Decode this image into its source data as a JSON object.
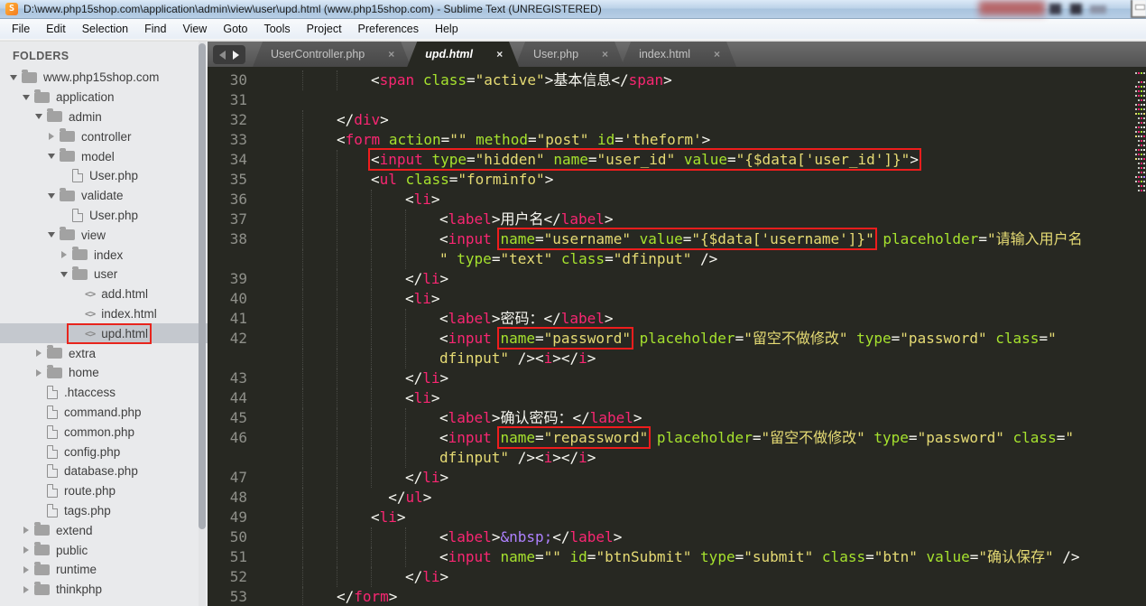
{
  "window": {
    "title": "D:\\www.php15shop.com\\application\\admin\\view\\user\\upd.html (www.php15shop.com) - Sublime Text (UNREGISTERED)",
    "logo_letter": "S",
    "menus": [
      "File",
      "Edit",
      "Selection",
      "Find",
      "View",
      "Goto",
      "Tools",
      "Project",
      "Preferences",
      "Help"
    ]
  },
  "tabs": [
    {
      "label": "UserController.php",
      "close": "×",
      "active": false
    },
    {
      "label": "upd.html",
      "close": "×",
      "active": true
    },
    {
      "label": "User.php",
      "close": "×",
      "active": false
    },
    {
      "label": "index.html",
      "close": "×",
      "active": false
    }
  ],
  "sidebar": {
    "header": "FOLDERS",
    "items": [
      {
        "label": "www.php15shop.com",
        "lv": 0,
        "icon": "folder",
        "arrow": "open"
      },
      {
        "label": "application",
        "lv": 1,
        "icon": "folder",
        "arrow": "open"
      },
      {
        "label": "admin",
        "lv": 2,
        "icon": "folder",
        "arrow": "open"
      },
      {
        "label": "controller",
        "lv": 3,
        "icon": "folder",
        "arrow": "closed"
      },
      {
        "label": "model",
        "lv": 3,
        "icon": "folder",
        "arrow": "open"
      },
      {
        "label": "User.php",
        "lv": 4,
        "icon": "file"
      },
      {
        "label": "validate",
        "lv": 3,
        "icon": "folder",
        "arrow": "open"
      },
      {
        "label": "User.php",
        "lv": 4,
        "icon": "file"
      },
      {
        "label": "view",
        "lv": 3,
        "icon": "folder",
        "arrow": "open"
      },
      {
        "label": "index",
        "lv": 4,
        "icon": "folder",
        "arrow": "closed"
      },
      {
        "label": "user",
        "lv": 4,
        "icon": "folder",
        "arrow": "open"
      },
      {
        "label": "add.html",
        "lv": 5,
        "icon": "html"
      },
      {
        "label": "index.html",
        "lv": 5,
        "icon": "html"
      },
      {
        "label": "upd.html",
        "lv": 5,
        "icon": "html",
        "selected": true,
        "boxed": true
      },
      {
        "label": "extra",
        "lv": 2,
        "icon": "folder",
        "arrow": "closed"
      },
      {
        "label": "home",
        "lv": 2,
        "icon": "folder",
        "arrow": "closed"
      },
      {
        "label": ".htaccess",
        "lv": 2,
        "icon": "file"
      },
      {
        "label": "command.php",
        "lv": 2,
        "icon": "file"
      },
      {
        "label": "common.php",
        "lv": 2,
        "icon": "file"
      },
      {
        "label": "config.php",
        "lv": 2,
        "icon": "file"
      },
      {
        "label": "database.php",
        "lv": 2,
        "icon": "file"
      },
      {
        "label": "route.php",
        "lv": 2,
        "icon": "file"
      },
      {
        "label": "tags.php",
        "lv": 2,
        "icon": "file"
      },
      {
        "label": "extend",
        "lv": 1,
        "icon": "folder",
        "arrow": "closed"
      },
      {
        "label": "public",
        "lv": 1,
        "icon": "folder",
        "arrow": "closed"
      },
      {
        "label": "runtime",
        "lv": 1,
        "icon": "folder",
        "arrow": "closed"
      },
      {
        "label": "thinkphp",
        "lv": 1,
        "icon": "folder",
        "arrow": "closed"
      }
    ]
  },
  "editor": {
    "colors": {
      "bg": "#272822",
      "tag": "#f92672",
      "attr": "#a6e22e",
      "string": "#e6db74",
      "entity": "#ae81ff",
      "plain": "#f8f8f2",
      "gutter": "#8f908a",
      "annotation": "#ee1d1d"
    },
    "rows": [
      {
        "n": "30",
        "i": 2,
        "t": [
          [
            "p",
            "<"
          ],
          [
            "t",
            "span"
          ],
          [
            "w",
            " "
          ],
          [
            "a",
            "class"
          ],
          [
            "p",
            "="
          ],
          [
            "s",
            "\"active\""
          ],
          [
            "p",
            ">"
          ],
          [
            "x",
            "基本信息"
          ],
          [
            "p",
            "</"
          ],
          [
            "t",
            "span"
          ],
          [
            "p",
            ">"
          ]
        ]
      },
      {
        "n": "31",
        "i": 0,
        "t": []
      },
      {
        "n": "32",
        "i": 1,
        "t": [
          [
            "p",
            "</"
          ],
          [
            "t",
            "div"
          ],
          [
            "p",
            ">"
          ]
        ]
      },
      {
        "n": "33",
        "i": 1,
        "t": [
          [
            "p",
            "<"
          ],
          [
            "t",
            "form"
          ],
          [
            "w",
            " "
          ],
          [
            "a",
            "action"
          ],
          [
            "p",
            "="
          ],
          [
            "s",
            "\"\""
          ],
          [
            "w",
            " "
          ],
          [
            "a",
            "method"
          ],
          [
            "p",
            "="
          ],
          [
            "s",
            "\"post\""
          ],
          [
            "w",
            " "
          ],
          [
            "a",
            "id"
          ],
          [
            "p",
            "="
          ],
          [
            "s",
            "'theform'"
          ],
          [
            "p",
            ">"
          ]
        ]
      },
      {
        "n": "34",
        "i": 2,
        "t": [
          [
            "b",
            [
              [
                "p",
                "<"
              ],
              [
                "t",
                "input"
              ],
              [
                "w",
                " "
              ],
              [
                "a",
                "type"
              ],
              [
                "p",
                "="
              ],
              [
                "s",
                "\"hidden\""
              ],
              [
                "w",
                " "
              ],
              [
                "a",
                "name"
              ],
              [
                "p",
                "="
              ],
              [
                "s",
                "\"user_id\""
              ],
              [
                "w",
                " "
              ],
              [
                "a",
                "value"
              ],
              [
                "p",
                "="
              ],
              [
                "s",
                "\"{$data['user_id']}\""
              ],
              [
                "p",
                ">"
              ]
            ]
          ]
        ]
      },
      {
        "n": "35",
        "i": 2,
        "t": [
          [
            "p",
            "<"
          ],
          [
            "t",
            "ul"
          ],
          [
            "w",
            " "
          ],
          [
            "a",
            "class"
          ],
          [
            "p",
            "="
          ],
          [
            "s",
            "\"forminfo\""
          ],
          [
            "p",
            ">"
          ]
        ]
      },
      {
        "n": "36",
        "i": 3,
        "t": [
          [
            "p",
            "<"
          ],
          [
            "t",
            "li"
          ],
          [
            "p",
            ">"
          ]
        ]
      },
      {
        "n": "37",
        "i": 4,
        "t": [
          [
            "p",
            "<"
          ],
          [
            "t",
            "label"
          ],
          [
            "p",
            ">"
          ],
          [
            "x",
            "用户名"
          ],
          [
            "p",
            "</"
          ],
          [
            "t",
            "label"
          ],
          [
            "p",
            ">"
          ]
        ]
      },
      {
        "n": "38",
        "i": 4,
        "t": [
          [
            "p",
            "<"
          ],
          [
            "t",
            "input"
          ],
          [
            "w",
            " "
          ],
          [
            "b",
            [
              [
                "a",
                "name"
              ],
              [
                "p",
                "="
              ],
              [
                "s",
                "\"username\""
              ],
              [
                "w",
                " "
              ],
              [
                "a",
                "value"
              ],
              [
                "p",
                "="
              ],
              [
                "s",
                "\"{$data['username']}\""
              ]
            ]
          ],
          [
            "w",
            " "
          ],
          [
            "a",
            "placeholder"
          ],
          [
            "p",
            "="
          ],
          [
            "s",
            "\"请输入用户名"
          ]
        ]
      },
      {
        "n": "",
        "i": 4,
        "t": [
          [
            "s",
            "\""
          ],
          [
            "w",
            " "
          ],
          [
            "a",
            "type"
          ],
          [
            "p",
            "="
          ],
          [
            "s",
            "\"text\""
          ],
          [
            "w",
            " "
          ],
          [
            "a",
            "class"
          ],
          [
            "p",
            "="
          ],
          [
            "s",
            "\"dfinput\""
          ],
          [
            "w",
            " "
          ],
          [
            "p",
            "/>"
          ]
        ]
      },
      {
        "n": "39",
        "i": 3,
        "t": [
          [
            "p",
            "</"
          ],
          [
            "t",
            "li"
          ],
          [
            "p",
            ">"
          ]
        ]
      },
      {
        "n": "40",
        "i": 3,
        "t": [
          [
            "p",
            "<"
          ],
          [
            "t",
            "li"
          ],
          [
            "p",
            ">"
          ]
        ]
      },
      {
        "n": "41",
        "i": 4,
        "t": [
          [
            "p",
            "<"
          ],
          [
            "t",
            "label"
          ],
          [
            "p",
            ">"
          ],
          [
            "x",
            "密码："
          ],
          [
            "p",
            "</"
          ],
          [
            "t",
            "label"
          ],
          [
            "p",
            ">"
          ]
        ]
      },
      {
        "n": "42",
        "i": 4,
        "t": [
          [
            "p",
            "<"
          ],
          [
            "t",
            "input"
          ],
          [
            "w",
            " "
          ],
          [
            "b",
            [
              [
                "a",
                "name"
              ],
              [
                "p",
                "="
              ],
              [
                "s",
                "\"password\""
              ]
            ]
          ],
          [
            "w",
            " "
          ],
          [
            "a",
            "placeholder"
          ],
          [
            "p",
            "="
          ],
          [
            "s",
            "\"留空不做修改\""
          ],
          [
            "w",
            " "
          ],
          [
            "a",
            "type"
          ],
          [
            "p",
            "="
          ],
          [
            "s",
            "\"password\""
          ],
          [
            "w",
            " "
          ],
          [
            "a",
            "class"
          ],
          [
            "p",
            "="
          ],
          [
            "s",
            "\""
          ]
        ]
      },
      {
        "n": "",
        "i": 4,
        "t": [
          [
            "s",
            "dfinput\""
          ],
          [
            "w",
            " "
          ],
          [
            "p",
            "/>"
          ],
          [
            "p",
            "<"
          ],
          [
            "t",
            "i"
          ],
          [
            "p",
            ">"
          ],
          [
            "p",
            "</"
          ],
          [
            "t",
            "i"
          ],
          [
            "p",
            ">"
          ]
        ]
      },
      {
        "n": "43",
        "i": 3,
        "t": [
          [
            "p",
            "</"
          ],
          [
            "t",
            "li"
          ],
          [
            "p",
            ">"
          ]
        ]
      },
      {
        "n": "44",
        "i": 3,
        "t": [
          [
            "p",
            "<"
          ],
          [
            "t",
            "li"
          ],
          [
            "p",
            ">"
          ]
        ]
      },
      {
        "n": "45",
        "i": 4,
        "t": [
          [
            "p",
            "<"
          ],
          [
            "t",
            "label"
          ],
          [
            "p",
            ">"
          ],
          [
            "x",
            "确认密码："
          ],
          [
            "p",
            "</"
          ],
          [
            "t",
            "label"
          ],
          [
            "p",
            ">"
          ]
        ]
      },
      {
        "n": "46",
        "i": 4,
        "t": [
          [
            "p",
            "<"
          ],
          [
            "t",
            "input"
          ],
          [
            "w",
            " "
          ],
          [
            "b",
            [
              [
                "a",
                "name"
              ],
              [
                "p",
                "="
              ],
              [
                "s",
                "\"repassword\""
              ]
            ]
          ],
          [
            "w",
            " "
          ],
          [
            "a",
            "placeholder"
          ],
          [
            "p",
            "="
          ],
          [
            "s",
            "\"留空不做修改\""
          ],
          [
            "w",
            " "
          ],
          [
            "a",
            "type"
          ],
          [
            "p",
            "="
          ],
          [
            "s",
            "\"password\""
          ],
          [
            "w",
            " "
          ],
          [
            "a",
            "class"
          ],
          [
            "p",
            "="
          ],
          [
            "s",
            "\""
          ]
        ]
      },
      {
        "n": "",
        "i": 4,
        "t": [
          [
            "s",
            "dfinput\""
          ],
          [
            "w",
            " "
          ],
          [
            "p",
            "/>"
          ],
          [
            "p",
            "<"
          ],
          [
            "t",
            "i"
          ],
          [
            "p",
            ">"
          ],
          [
            "p",
            "</"
          ],
          [
            "t",
            "i"
          ],
          [
            "p",
            ">"
          ]
        ]
      },
      {
        "n": "47",
        "i": 3,
        "t": [
          [
            "p",
            "</"
          ],
          [
            "t",
            "li"
          ],
          [
            "p",
            ">"
          ]
        ]
      },
      {
        "n": "48",
        "i": 2,
        "t": [
          [
            "w",
            "  "
          ],
          [
            "p",
            "</"
          ],
          [
            "t",
            "ul"
          ],
          [
            "p",
            ">"
          ]
        ]
      },
      {
        "n": "49",
        "i": 2,
        "t": [
          [
            "p",
            "<"
          ],
          [
            "t",
            "li"
          ],
          [
            "p",
            ">"
          ]
        ]
      },
      {
        "n": "50",
        "i": 4,
        "t": [
          [
            "p",
            "<"
          ],
          [
            "t",
            "label"
          ],
          [
            "p",
            ">"
          ],
          [
            "e",
            "&nbsp;"
          ],
          [
            "p",
            "</"
          ],
          [
            "t",
            "label"
          ],
          [
            "p",
            ">"
          ]
        ]
      },
      {
        "n": "51",
        "i": 4,
        "t": [
          [
            "p",
            "<"
          ],
          [
            "t",
            "input"
          ],
          [
            "w",
            " "
          ],
          [
            "a",
            "name"
          ],
          [
            "p",
            "="
          ],
          [
            "s",
            "\"\""
          ],
          [
            "w",
            " "
          ],
          [
            "a",
            "id"
          ],
          [
            "p",
            "="
          ],
          [
            "s",
            "\"btnSubmit\""
          ],
          [
            "w",
            " "
          ],
          [
            "a",
            "type"
          ],
          [
            "p",
            "="
          ],
          [
            "s",
            "\"submit\""
          ],
          [
            "w",
            " "
          ],
          [
            "a",
            "class"
          ],
          [
            "p",
            "="
          ],
          [
            "s",
            "\"btn\""
          ],
          [
            "w",
            " "
          ],
          [
            "a",
            "value"
          ],
          [
            "p",
            "="
          ],
          [
            "s",
            "\"确认保存\""
          ],
          [
            "w",
            " "
          ],
          [
            "p",
            "/>"
          ]
        ]
      },
      {
        "n": "52",
        "i": 3,
        "t": [
          [
            "p",
            "</"
          ],
          [
            "t",
            "li"
          ],
          [
            "p",
            ">"
          ]
        ]
      },
      {
        "n": "53",
        "i": 1,
        "t": [
          [
            "p",
            "</"
          ],
          [
            "t",
            "form"
          ],
          [
            "p",
            ">"
          ]
        ]
      }
    ]
  }
}
